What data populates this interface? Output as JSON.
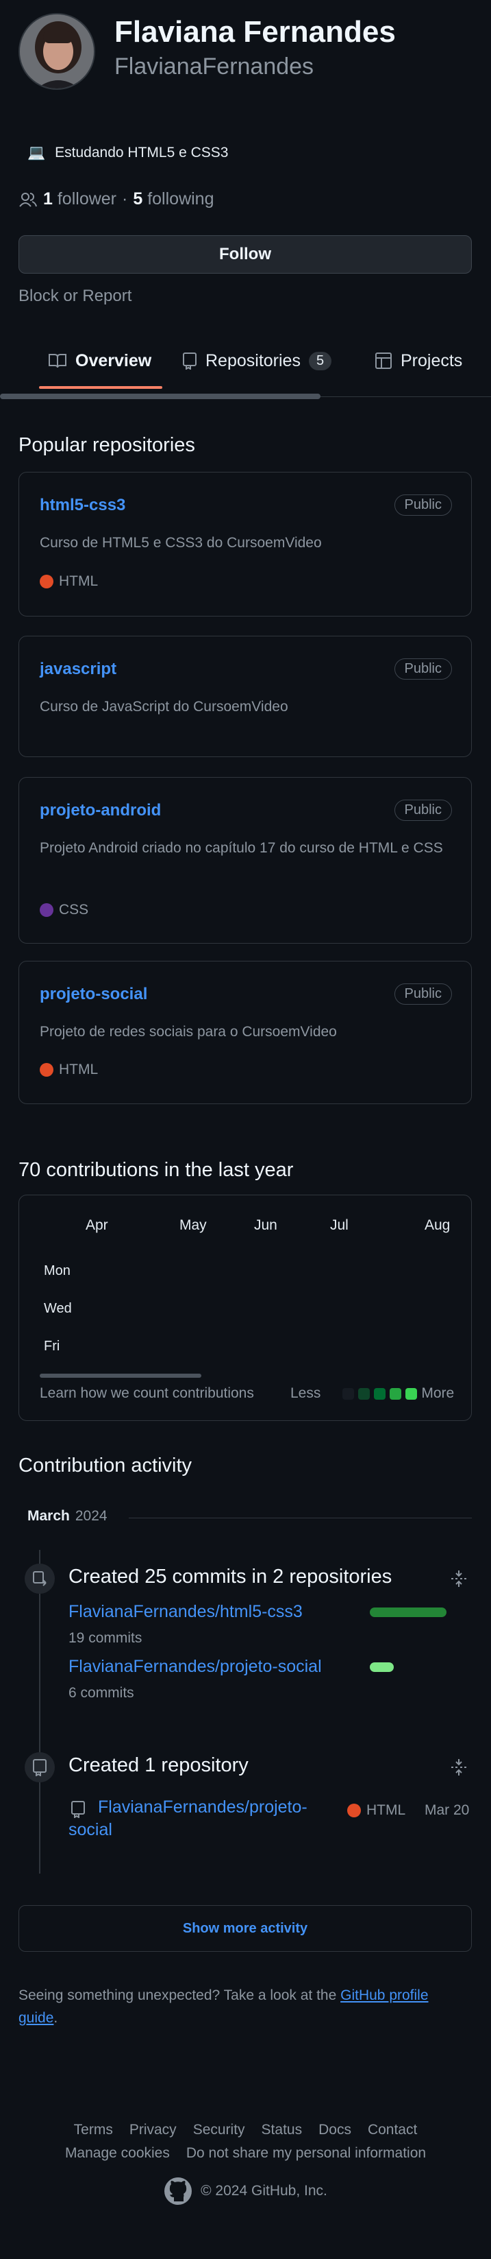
{
  "profile": {
    "name": "Flaviana Fernandes",
    "login": "FlavianaFernandes",
    "status_emoji": "💻",
    "status_text": "Estudando HTML5 e CSS3",
    "followers_count": "1",
    "followers_label": "follower",
    "separator": "·",
    "following_count": "5",
    "following_label": "following",
    "follow_button": "Follow",
    "block_report": "Block or Report"
  },
  "tabs": [
    {
      "label": "Overview",
      "icon": "book-icon",
      "selected": true
    },
    {
      "label": "Repositories",
      "icon": "repo-icon",
      "count": "5"
    },
    {
      "label": "Projects",
      "icon": "table-icon"
    }
  ],
  "popular": {
    "title": "Popular repositories",
    "repos": [
      {
        "name": "html5-css3",
        "visibility": "Public",
        "description": "Curso de HTML5 e CSS3 do CursoemVideo",
        "language": "HTML",
        "language_color": "#e34c26"
      },
      {
        "name": "javascript",
        "visibility": "Public",
        "description": "Curso de JavaScript do CursoemVideo"
      },
      {
        "name": "projeto-android",
        "visibility": "Public",
        "description": "Projeto Android criado no capítulo 17 do curso de HTML e CSS",
        "language": "CSS",
        "language_color": "#663399"
      },
      {
        "name": "projeto-social",
        "visibility": "Public",
        "description": "Projeto de redes sociais para o CursoemVideo",
        "language": "HTML",
        "language_color": "#e34c26"
      }
    ]
  },
  "contributions": {
    "title": "70 contributions in the last year",
    "months": [
      "Apr",
      "May",
      "Jun",
      "Jul",
      "Aug"
    ],
    "days": [
      "Mon",
      "Wed",
      "Fri"
    ],
    "learn_link": "Learn how we count contributions",
    "less": "Less",
    "more": "More",
    "legend_colors": [
      "#161b22",
      "#0e4429",
      "#006d32",
      "#26a641",
      "#39d353"
    ]
  },
  "activity": {
    "title": "Contribution activity",
    "month": "March",
    "year": "2024",
    "commits": {
      "title": "Created 25 commits in 2 repositories",
      "repos": [
        {
          "name": "FlavianaFernandes/html5-css3",
          "commits": "19 commits",
          "share": 0.76
        },
        {
          "name": "FlavianaFernandes/projeto-social",
          "commits": "6 commits",
          "share": 0.24
        }
      ]
    },
    "created": {
      "title": "Created 1 repository",
      "repo_line1": "FlavianaFernandes/projeto-",
      "repo_line2": "social",
      "language": "HTML",
      "language_color": "#e34c26",
      "date": "Mar 20"
    },
    "show_more": "Show more activity"
  },
  "unexpected": {
    "text": "Seeing something unexpected? Take a look at the",
    "link_line1": "GitHub profile",
    "link_line2": "guide",
    "period": "."
  },
  "footer": {
    "links_row1": [
      "Terms",
      "Privacy",
      "Security",
      "Status",
      "Docs",
      "Contact"
    ],
    "links_row2": [
      "Manage cookies",
      "Do not share my personal information"
    ],
    "copyright": "© 2024 GitHub, Inc."
  }
}
